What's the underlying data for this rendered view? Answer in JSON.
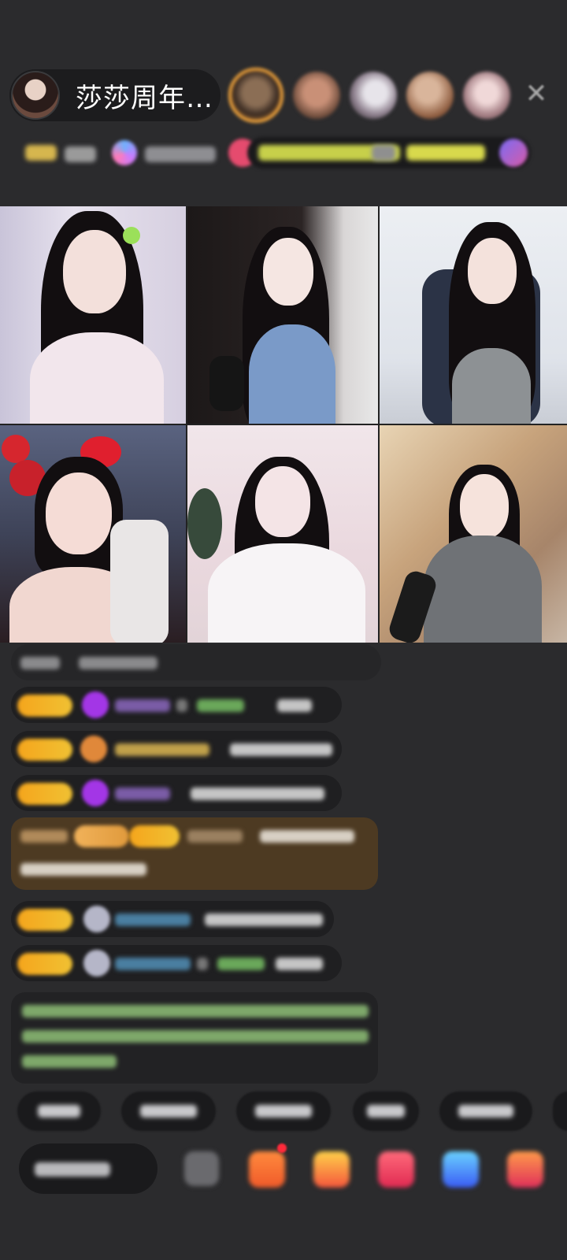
{
  "room": {
    "anchor_name": "莎莎周年…"
  },
  "top_bar": {
    "viewer_avatar_count": 5,
    "close_icon": "close-icon"
  },
  "grid": {
    "tiles": [
      {
        "position": "top-left"
      },
      {
        "position": "top-center"
      },
      {
        "position": "top-right"
      },
      {
        "position": "bottom-left"
      },
      {
        "position": "bottom-center"
      },
      {
        "position": "bottom-right"
      }
    ]
  },
  "colors": {
    "background": "#2b2b2d",
    "badge_gold": "#f5a51c",
    "viewer_ring": "#f0a33b"
  }
}
